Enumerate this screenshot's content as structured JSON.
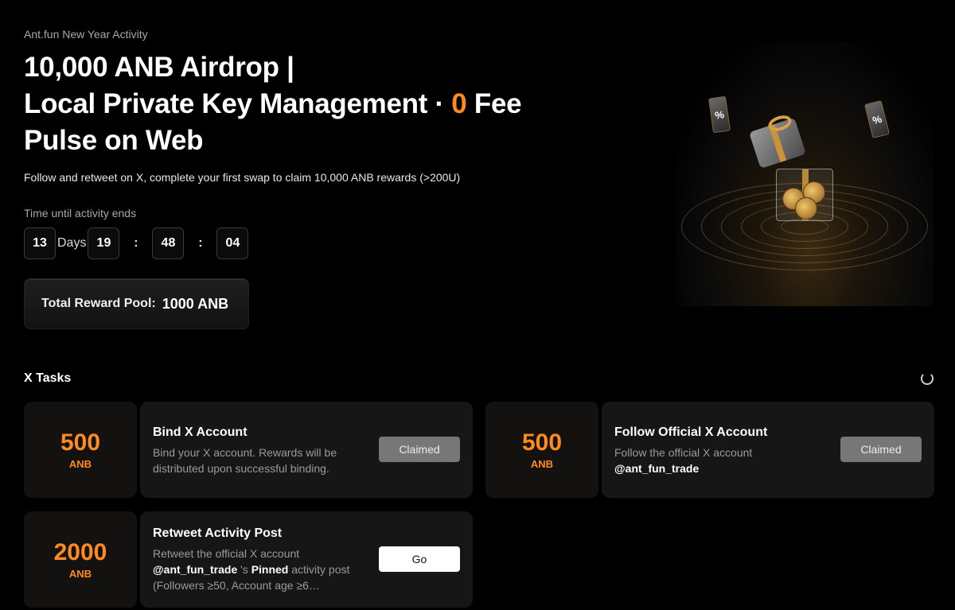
{
  "header": {
    "eyebrow": "Ant.fun New Year Activity",
    "line1": "10,000 ANB Airdrop |",
    "line2_pre": "Local Private Key Management · ",
    "line2_accent": "0",
    "line2_post": " Fee",
    "line3": "Pulse on Web",
    "subtitle": "Follow and retweet on X, complete your first swap to claim 10,000 ANB rewards (>200U)"
  },
  "countdown": {
    "label": "Time until activity ends",
    "days": "13",
    "days_unit": "Days",
    "hours": "19",
    "minutes": "48",
    "seconds": "04",
    "separator": ":"
  },
  "pool": {
    "label": "Total Reward Pool:",
    "value": "1000 ANB"
  },
  "hero_image": {
    "tag_left": "%",
    "tag_right": "%"
  },
  "tasks_section": {
    "title": "X Tasks",
    "refresh_icon": "refresh-icon"
  },
  "tasks": [
    {
      "amount": "500",
      "unit": "ANB",
      "title": "Bind X Account",
      "desc": "Bind your X account. Rewards will be distributed upon successful binding.",
      "button": "Claimed"
    },
    {
      "amount": "500",
      "unit": "ANB",
      "title": "Follow Official X Account",
      "desc": "Follow the official X account",
      "handle": "@ant_fun_trade",
      "button": "Claimed"
    },
    {
      "amount": "2000",
      "unit": "ANB",
      "title": "Retweet Activity Post",
      "desc_pre": "Retweet the official X account",
      "handle": "@ant_fun_trade",
      "desc_mid": " 's ",
      "desc_bold": "Pinned",
      "desc_post": " activity post (Followers ≥50, Account age ≥6…",
      "button": "Go"
    }
  ],
  "colors": {
    "accent": "#ff8a1e",
    "background": "#000000",
    "card": "#161616",
    "claimed_button": "#777777"
  }
}
